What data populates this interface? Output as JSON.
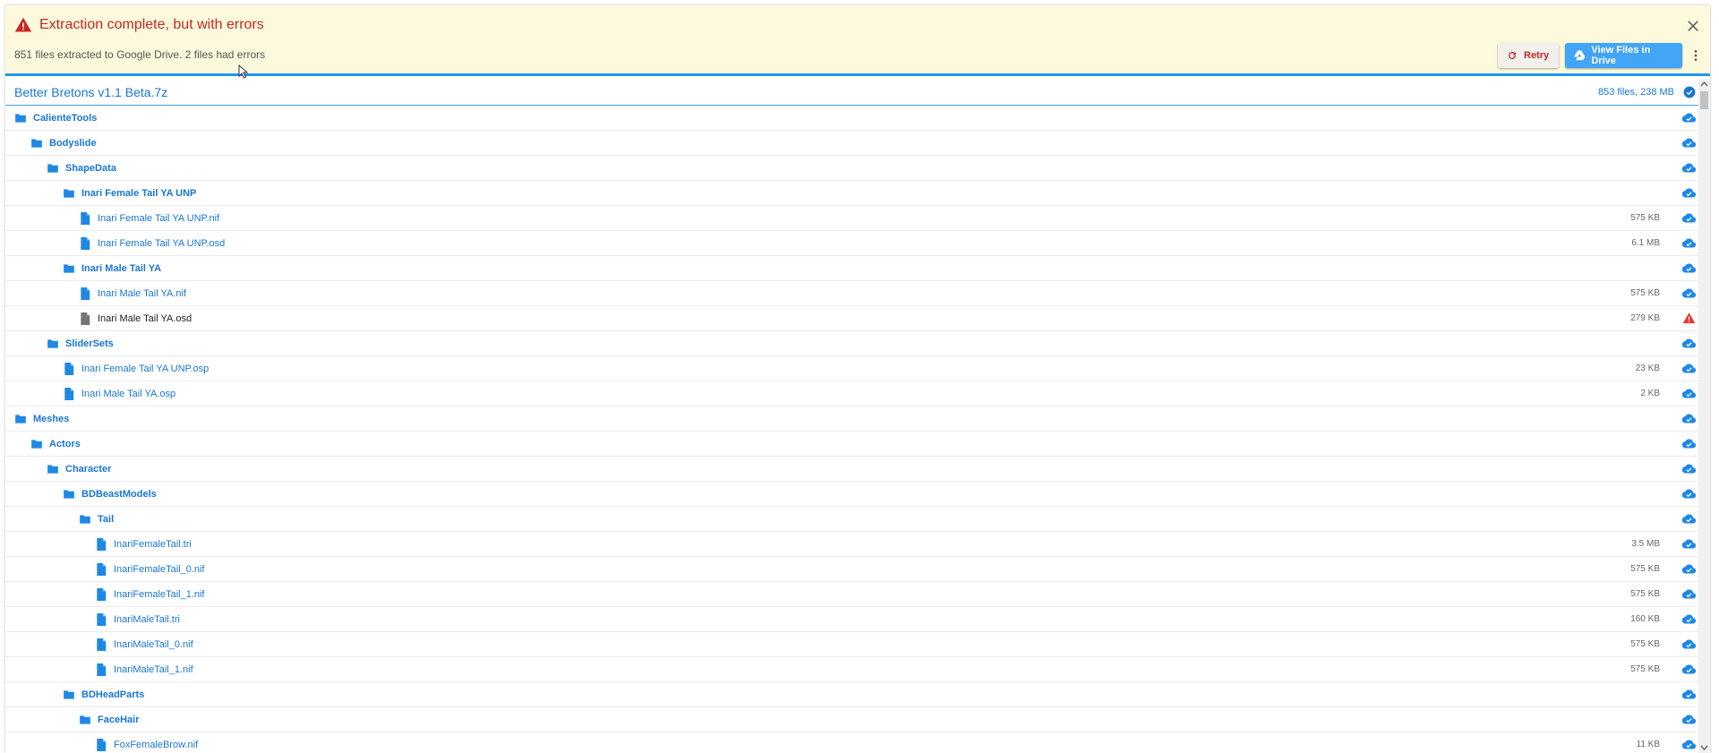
{
  "banner": {
    "title": "Extraction complete, but with errors",
    "message": "851 files extracted to Google Drive. 2 files had errors",
    "retry_label": "Retry",
    "view_label": "View Files in Drive"
  },
  "archive": {
    "name": "Better Bretons v1.1 Beta.7z",
    "meta": "853 files, 238 MB"
  },
  "colors": {
    "accent": "#2196f3",
    "error": "#c62828",
    "banner_bg": "#fdf9dc",
    "link": "#1976d2"
  },
  "rows": [
    {
      "type": "folder",
      "depth": 0,
      "name": "CalienteTools",
      "size": "",
      "status": "cloud-done-icon"
    },
    {
      "type": "folder",
      "depth": 1,
      "name": "Bodyslide",
      "size": "",
      "status": "cloud-done-icon"
    },
    {
      "type": "folder",
      "depth": 2,
      "name": "ShapeData",
      "size": "",
      "status": "cloud-done-icon"
    },
    {
      "type": "folder",
      "depth": 3,
      "name": "Inari Female Tail YA UNP",
      "size": "",
      "status": "cloud-done-icon"
    },
    {
      "type": "file",
      "depth": 4,
      "name": "Inari Female Tail YA UNP.nif",
      "size": "575 KB",
      "status": "cloud-done-icon"
    },
    {
      "type": "file",
      "depth": 4,
      "name": "Inari Female Tail YA UNP.osd",
      "size": "6.1 MB",
      "status": "cloud-done-icon"
    },
    {
      "type": "folder",
      "depth": 3,
      "name": "Inari Male Tail YA",
      "size": "",
      "status": "cloud-done-icon"
    },
    {
      "type": "file",
      "depth": 4,
      "name": "Inari Male Tail YA.nif",
      "size": "575 KB",
      "status": "cloud-done-icon"
    },
    {
      "type": "error",
      "depth": 4,
      "name": "Inari Male Tail YA.osd",
      "size": "279 KB",
      "status": "warning-icon"
    },
    {
      "type": "folder",
      "depth": 2,
      "name": "SliderSets",
      "size": "",
      "status": "cloud-done-icon"
    },
    {
      "type": "file",
      "depth": 3,
      "name": "Inari Female Tail YA UNP.osp",
      "size": "23 KB",
      "status": "cloud-done-icon"
    },
    {
      "type": "file",
      "depth": 3,
      "name": "Inari Male Tail YA.osp",
      "size": "2 KB",
      "status": "cloud-done-icon"
    },
    {
      "type": "folder",
      "depth": 0,
      "name": "Meshes",
      "size": "",
      "status": "cloud-done-icon"
    },
    {
      "type": "folder",
      "depth": 1,
      "name": "Actors",
      "size": "",
      "status": "cloud-done-icon"
    },
    {
      "type": "folder",
      "depth": 2,
      "name": "Character",
      "size": "",
      "status": "cloud-done-icon"
    },
    {
      "type": "folder",
      "depth": 3,
      "name": "BDBeastModels",
      "size": "",
      "status": "cloud-done-icon"
    },
    {
      "type": "folder",
      "depth": 4,
      "name": "Tail",
      "size": "",
      "status": "cloud-done-icon"
    },
    {
      "type": "file",
      "depth": 5,
      "name": "InariFemaleTail.tri",
      "size": "3.5 MB",
      "status": "cloud-done-icon"
    },
    {
      "type": "file",
      "depth": 5,
      "name": "InariFemaleTail_0.nif",
      "size": "575 KB",
      "status": "cloud-done-icon"
    },
    {
      "type": "file",
      "depth": 5,
      "name": "InariFemaleTail_1.nif",
      "size": "575 KB",
      "status": "cloud-done-icon"
    },
    {
      "type": "file",
      "depth": 5,
      "name": "InariMaleTail.tri",
      "size": "160 KB",
      "status": "cloud-done-icon"
    },
    {
      "type": "file",
      "depth": 5,
      "name": "InariMaleTail_0.nif",
      "size": "575 KB",
      "status": "cloud-done-icon"
    },
    {
      "type": "file",
      "depth": 5,
      "name": "InariMaleTail_1.nif",
      "size": "575 KB",
      "status": "cloud-done-icon"
    },
    {
      "type": "folder",
      "depth": 3,
      "name": "BDHeadParts",
      "size": "",
      "status": "cloud-done-icon"
    },
    {
      "type": "folder",
      "depth": 4,
      "name": "FaceHair",
      "size": "",
      "status": "cloud-done-icon"
    },
    {
      "type": "file",
      "depth": 5,
      "name": "FoxFemaleBrow.nif",
      "size": "11 KB",
      "status": "cloud-done-icon"
    }
  ]
}
